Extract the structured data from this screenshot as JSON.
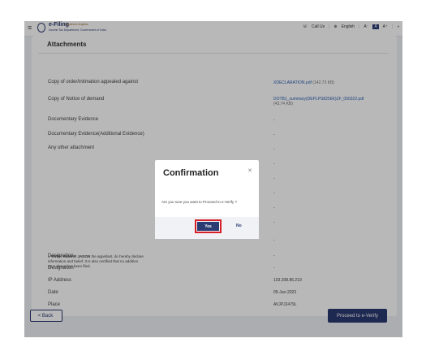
{
  "header": {
    "logo_text": "e-Filing",
    "logo_tag": "Anywhere Anytime",
    "logo_subtitle": "Income Tax Department, Government of India",
    "call_us": "Call Us",
    "language": "English",
    "font_decrease": "A⁻",
    "font_reset": "A",
    "font_increase": "A⁺"
  },
  "card": {
    "title": "Attachments",
    "rows": [
      {
        "label": "Copy of order/intimation appealed against",
        "value": "XDECLARATION.pdf",
        "size": "(142.73 KB)"
      },
      {
        "label": "Copy of Notice of demand",
        "value": "DOTB1_summary(DEPLPS8256K)ZF_050322.pdf",
        "size": "(43.74 KB)"
      },
      {
        "label": "Documentary Evidence",
        "value": "-"
      },
      {
        "label": "Documentary Evidence(Additional Evidence)",
        "value": "-"
      },
      {
        "label": "Any other attachment",
        "value": "-"
      }
    ],
    "extra_dashes": [
      "-",
      "-",
      "-",
      "-",
      "-",
      "-"
    ],
    "declaration": {
      "name": "VIVEK KUMAR JADON",
      "line1": "the appellant, do hereby declare",
      "line2": "information and belief. It is also certified that no addition",
      "line3": "12.1 above has been filed."
    },
    "details": [
      {
        "label": "Designation",
        "value": "-"
      },
      {
        "label": "Designation",
        "value": "-"
      },
      {
        "label": "IP Address",
        "value": "103.208.86.219"
      },
      {
        "label": "Date",
        "value": "05-Jun-2023"
      },
      {
        "label": "Place",
        "value": "AVJPJ2479L"
      }
    ]
  },
  "modal": {
    "title": "Confirmation",
    "message": "Are you sure you want to Proceed to e-Verify ?",
    "yes_label": "Yes",
    "no_label": "No"
  },
  "footer": {
    "back_label": "< Back",
    "proceed_label": "Proceed to e-Verify"
  },
  "colors": {
    "primary": "#2a3a72",
    "highlight": "#d61f26",
    "link": "#2a5db0"
  }
}
